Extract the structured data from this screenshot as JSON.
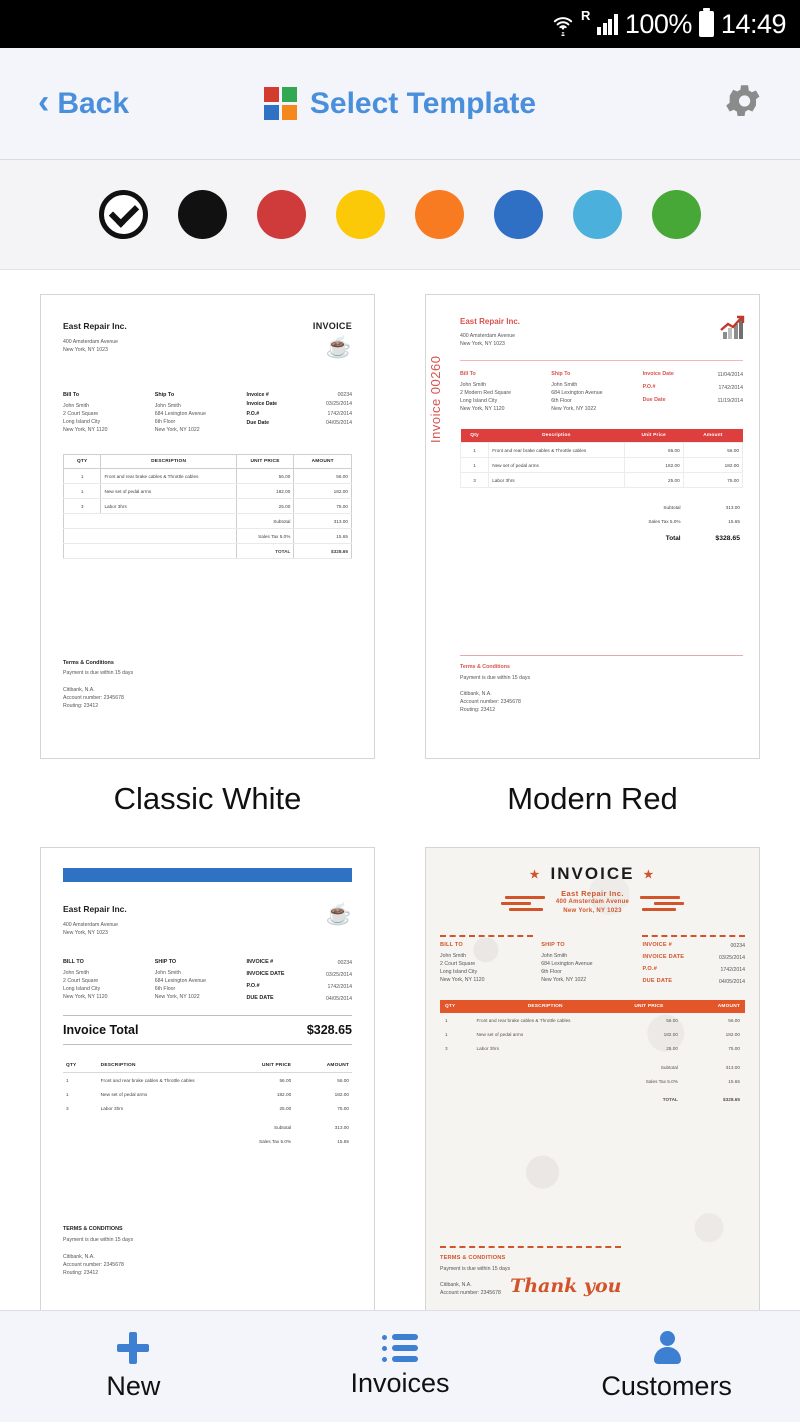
{
  "statusbar": {
    "wifi_icon": "wifi-icon",
    "roaming_label": "R",
    "signal_icon": "signal-bars-icon",
    "battery_percent": "100%",
    "battery_icon": "battery-full-icon",
    "time": "14:49"
  },
  "header": {
    "back_label": "Back",
    "back_icon": "chevron-left-icon",
    "title": "Select Template",
    "logo_icon": "template-grid-icon",
    "settings_icon": "gear-icon",
    "accent_color": "#4a8fdb"
  },
  "colors": {
    "swatches": [
      {
        "name": "selected-check",
        "hex": "#ffffff",
        "selected": true
      },
      {
        "name": "black",
        "hex": "#111111",
        "selected": false
      },
      {
        "name": "red",
        "hex": "#cf3b3b",
        "selected": false
      },
      {
        "name": "yellow",
        "hex": "#fcc908",
        "selected": false
      },
      {
        "name": "orange",
        "hex": "#f97b21",
        "selected": false
      },
      {
        "name": "blue",
        "hex": "#2f6fc4",
        "selected": false
      },
      {
        "name": "light-blue",
        "hex": "#4bb0dc",
        "selected": false
      },
      {
        "name": "green",
        "hex": "#48a837",
        "selected": false
      }
    ]
  },
  "templates": [
    {
      "id": "classic-white",
      "name": "Classic White",
      "accent": "#222222"
    },
    {
      "id": "modern-red",
      "name": "Modern Red",
      "accent": "#dd3f3f"
    },
    {
      "id": "blue-bar",
      "name": "",
      "accent": "#2f72c4"
    },
    {
      "id": "vintage-orange",
      "name": "",
      "accent": "#e2562a"
    }
  ],
  "invoice": {
    "company_name": "East Repair Inc.",
    "company_address_line1": "400 Amsterdam Avenue",
    "company_address_line2": "New York, NY 1023",
    "invoice_word": "INVOICE",
    "invoice_number_vertical": "Invoice 00260",
    "bill_to_label": "Bill To",
    "bill_to_label_caps": "BILL TO",
    "ship_to_label": "Ship To",
    "ship_to_label_caps": "SHIP TO",
    "bill_to": [
      "John Smith",
      "2 Court Square",
      "Long Island City",
      "New York, NY 1120"
    ],
    "bill_to_red": [
      "John Smith",
      "2 Modern Red Square",
      "Long Island City",
      "New York, NY 1120"
    ],
    "ship_to": [
      "John Smith",
      "684 Lexington Avenue",
      "6th Floor",
      "New York, NY 1022"
    ],
    "meta": [
      {
        "label": "Invoice #",
        "label_caps": "INVOICE #",
        "value": "00234"
      },
      {
        "label": "Invoice Date",
        "label_caps": "INVOICE DATE",
        "value": "03/25/2014"
      },
      {
        "label": "P.O.#",
        "label_caps": "P.O.#",
        "value": "1742/2014"
      },
      {
        "label": "Due Date",
        "label_caps": "DUE DATE",
        "value": "04/05/2014"
      }
    ],
    "meta_red": [
      {
        "label": "Invoice Date",
        "value": "11/04/2014"
      },
      {
        "label": "P.O.#",
        "value": "1742/2014"
      },
      {
        "label": "Due Date",
        "value": "11/19/2014"
      }
    ],
    "columns": [
      "QTY",
      "DESCRIPTION",
      "UNIT PRICE",
      "AMOUNT"
    ],
    "columns_title": [
      "Qty",
      "Description",
      "Unit Price",
      "Amount"
    ],
    "items": [
      {
        "qty": "1",
        "description": "Front and rear brake cables & Throttle cables",
        "unit_price": "56.00",
        "amount": "56.00"
      },
      {
        "qty": "1",
        "description": "New set of pedal arms",
        "unit_price": "182.00",
        "amount": "182.00"
      },
      {
        "qty": "3",
        "description": "Labor 3hrs",
        "unit_price": "25.00",
        "amount": "75.00"
      }
    ],
    "subtotal_label": "Subtotal",
    "subtotal_value": "313.00",
    "tax_label": "Sales Tax 5.0%",
    "tax_value": "15.65",
    "total_label": "TOTAL",
    "total_label_title": "Total",
    "total_value": "$328.65",
    "invoice_total_label": "Invoice Total",
    "terms_title": "Terms & Conditions",
    "terms_title_caps": "TERMS & CONDITIONS",
    "terms_text": "Payment is due within 15 days",
    "bank_name": "Citibank, N.A.",
    "bank_account": "Account number: 2345678",
    "bank_routing": "Routing: 23412",
    "thank_you": "Thank you",
    "cup_icon": "coffee-cup-icon",
    "chart_icon": "growth-chart-icon"
  },
  "bottomnav": {
    "items": [
      {
        "label": "New",
        "icon": "plus-icon"
      },
      {
        "label": "Invoices",
        "icon": "list-icon"
      },
      {
        "label": "Customers",
        "icon": "person-icon"
      }
    ],
    "accent": "#3d7fd1"
  }
}
